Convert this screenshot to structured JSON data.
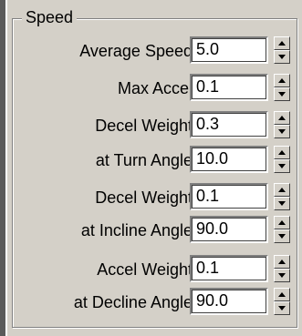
{
  "group": {
    "title": "Speed"
  },
  "fields": [
    {
      "label": "Average Speed:",
      "value": "5.0"
    },
    {
      "label": "Max Accel:",
      "value": "0.1"
    },
    {
      "label": "Decel Weight:",
      "value": "0.3"
    },
    {
      "label": "at Turn Angle:",
      "value": "10.0"
    },
    {
      "label": "Decel Weight:",
      "value": "0.1"
    },
    {
      "label": "at Incline Angle:",
      "value": "90.0"
    },
    {
      "label": "Accel Weight:",
      "value": "0.1"
    },
    {
      "label": "at Decline Angle:",
      "value": "90.0"
    }
  ],
  "icons": {
    "spinner_up": "triangle-up-icon",
    "spinner_down": "triangle-down-icon"
  },
  "colors": {
    "panel_bg": "#d4d0c8",
    "field_bg": "#ffffff"
  }
}
